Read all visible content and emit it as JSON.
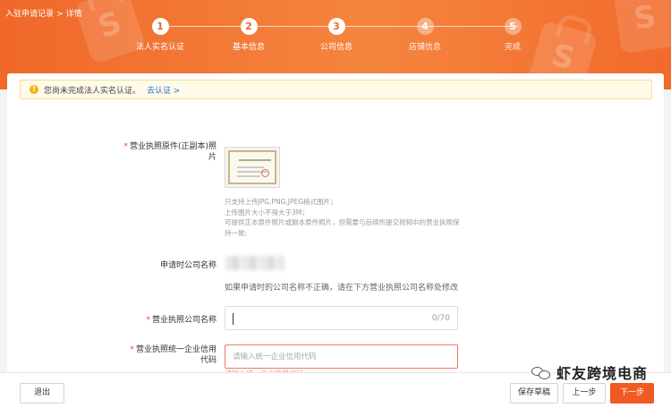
{
  "breadcrumb": {
    "parent": "入驻申请记录",
    "sep": ">",
    "current": "详情"
  },
  "steps": [
    {
      "num": "1",
      "label": "法人实名认证",
      "state": "done"
    },
    {
      "num": "2",
      "label": "基本信息",
      "state": "done"
    },
    {
      "num": "3",
      "label": "公司信息",
      "state": "current"
    },
    {
      "num": "4",
      "label": "店铺信息",
      "state": "future"
    },
    {
      "num": "5",
      "label": "完成",
      "state": "future"
    }
  ],
  "notice": {
    "text": "您尚未完成法人实名认证。",
    "link": "去认证 >"
  },
  "form": {
    "license_photo": {
      "required": "*",
      "label_line1": "营业执照原件(正副本)照",
      "label_line2": "片",
      "hints": [
        "只支持上传JPG,PNG,JPEG格式图片；",
        "上传图片大小不得大于3M；",
        "可提供正本原件照片或副本原件照片，但需要与后续所提交视频中的营业执照保",
        "持一致;"
      ]
    },
    "apply_company": {
      "label": "申请时公司名称",
      "note": "如果申请时的公司名称不正确，请在下方营业执照公司名称处修改"
    },
    "license_company": {
      "required": "*",
      "label": "营业执照公司名称",
      "value": "",
      "counter": "0/70"
    },
    "credit_code": {
      "required": "*",
      "label_line1": "营业执照统一企业信用",
      "label_line2": "代码",
      "placeholder": "请输入统一企业信用代码",
      "error": "请输入统一企业信用代码"
    }
  },
  "footer": {
    "exit": "退出",
    "save_draft": "保存草稿",
    "prev": "上一步",
    "next": "下一步"
  },
  "watermark": {
    "text": "虾友跨境电商"
  },
  "colors": {
    "brand": "#f15a22",
    "link": "#1f6fd8",
    "error": "#e8432d"
  }
}
